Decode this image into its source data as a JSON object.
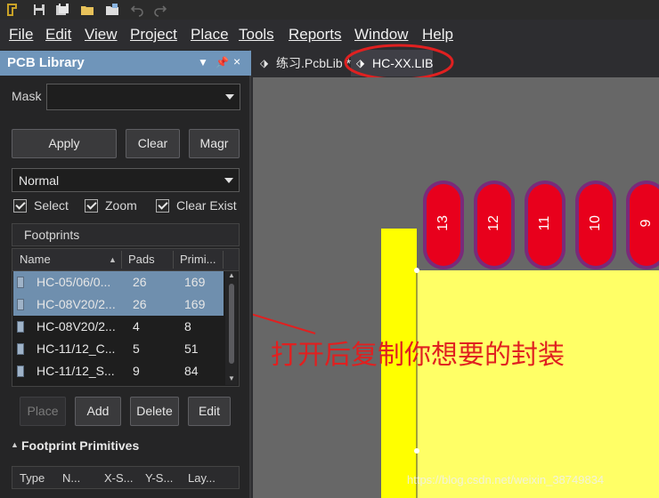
{
  "menubar": [
    {
      "id": "file",
      "label": "File"
    },
    {
      "id": "edit",
      "label": "Edit"
    },
    {
      "id": "view",
      "label": "View"
    },
    {
      "id": "project",
      "label": "Project"
    },
    {
      "id": "place",
      "label": "Place"
    },
    {
      "id": "tools",
      "label": "Tools"
    },
    {
      "id": "reports",
      "label": "Reports"
    },
    {
      "id": "window",
      "label": "Window"
    },
    {
      "id": "help",
      "label": "Help"
    }
  ],
  "panel": {
    "title": "PCB Library",
    "mask_label": "Mask",
    "mask_value": "",
    "apply_label": "Apply",
    "clear_label": "Clear",
    "magnify_label": "Magr",
    "mode_value": "Normal",
    "select_label": "Select",
    "zoom_label": "Zoom",
    "clear_existing_label": "Clear Exist",
    "footprints_header": "Footprints",
    "columns": {
      "name": "Name",
      "pads": "Pads",
      "primitives": "Primi..."
    },
    "rows": [
      {
        "name": "HC-05/06/0...",
        "pads": "26",
        "prims": "169",
        "selected": true
      },
      {
        "name": "HC-08V20/2...",
        "pads": "26",
        "prims": "169",
        "selected": true
      },
      {
        "name": "HC-08V20/2...",
        "pads": "4",
        "prims": "8",
        "selected": false
      },
      {
        "name": "HC-11/12_C...",
        "pads": "5",
        "prims": "51",
        "selected": false
      },
      {
        "name": "HC-11/12_S...",
        "pads": "9",
        "prims": "84",
        "selected": false
      }
    ],
    "place_label": "Place",
    "add_label": "Add",
    "delete_label": "Delete",
    "edit_label": "Edit",
    "primitives_header": "Footprint Primitives",
    "prim_columns": {
      "type": "Type",
      "n": "N...",
      "xs": "X-S...",
      "ys": "Y-S...",
      "layer": "Lay..."
    }
  },
  "tabs": [
    {
      "label": "练习.PcbLib *",
      "active": false
    },
    {
      "label": "HC-XX.LIB",
      "active": true
    }
  ],
  "canvas": {
    "pads": [
      "13",
      "12",
      "11",
      "10",
      "9"
    ],
    "pad_fill": "#e8001c",
    "pad_ring": "#7a2a7a",
    "body_fill": "#ffff66",
    "silkscreen": "#ffff00"
  },
  "annotation_text": "打开后复制你想要的封装",
  "watermark_text": "https://blog.csdn.net/weixin_38749834",
  "colors": {
    "accent": "#6f95ba",
    "annotation": "#e02020"
  }
}
